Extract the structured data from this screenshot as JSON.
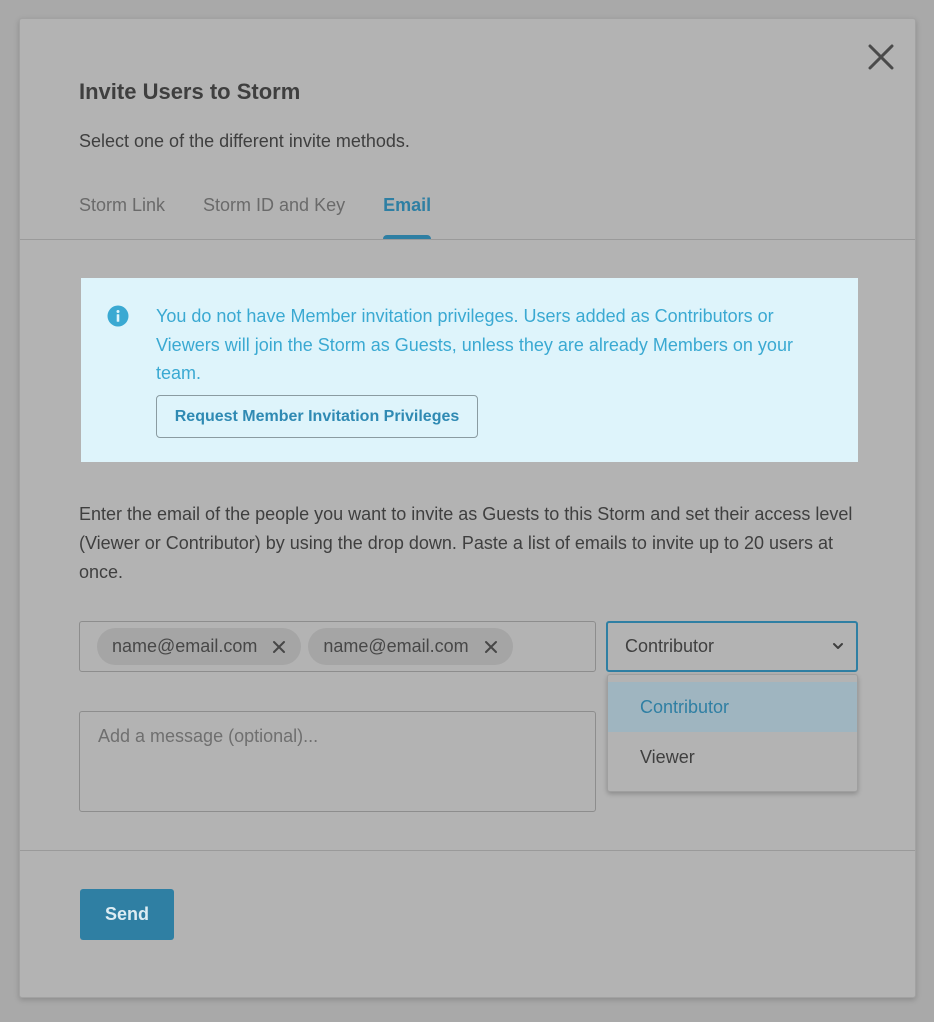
{
  "modal": {
    "title": "Invite Users to Storm",
    "subtitle": "Select one of the different invite methods."
  },
  "tabs": [
    {
      "label": "Storm Link",
      "active": false
    },
    {
      "label": "Storm ID and Key",
      "active": false
    },
    {
      "label": "Email",
      "active": true
    }
  ],
  "notice": {
    "icon": "info-icon",
    "text": "You do not have Member invitation privileges. Users added as Contributors or Viewers will join the Storm as Guests, unless they are already Members on your team.",
    "button_label": "Request Member Invitation Privileges"
  },
  "description": "Enter the email of the people you want to invite as Guests to this Storm and set their access level (Viewer or Contributor) by using the drop down. Paste a list of emails to invite up to 20 users at once.",
  "emails": {
    "chips": [
      "name@email.com",
      "name@email.com"
    ]
  },
  "access_select": {
    "selected": "Contributor",
    "options": [
      "Contributor",
      "Viewer"
    ]
  },
  "message": {
    "placeholder": "Add a message (optional)..."
  },
  "send_label": "Send",
  "colors": {
    "accent": "#2f7fa3",
    "notice_bg": "#def4fb",
    "notice_text": "#3aa9d2"
  }
}
